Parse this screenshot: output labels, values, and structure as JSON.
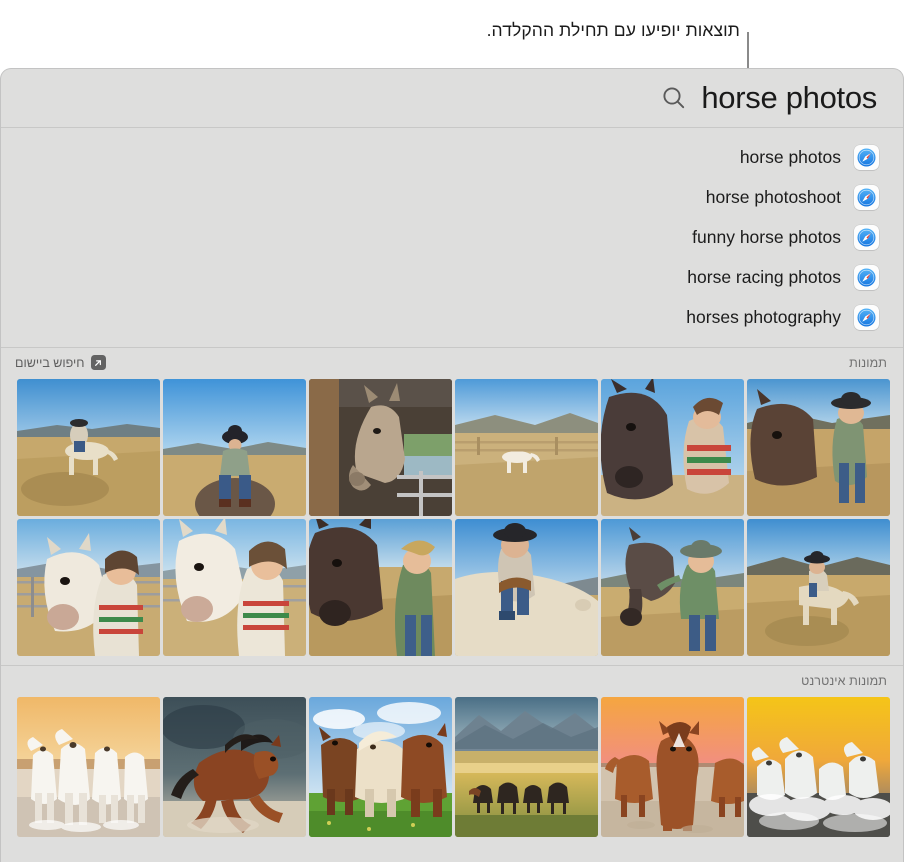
{
  "callout": {
    "text": "תוצאות יופיעו עם תחילת ההקלדה."
  },
  "search": {
    "value": "horse photos",
    "icon": "search-icon"
  },
  "suggestions": [
    {
      "label": "horse photos",
      "icon": "safari-compass-icon"
    },
    {
      "label": "horse photoshoot",
      "icon": "safari-compass-icon"
    },
    {
      "label": "funny horse photos",
      "icon": "safari-compass-icon"
    },
    {
      "label": "horse racing photos",
      "icon": "safari-compass-icon"
    },
    {
      "label": "horses photography",
      "icon": "safari-compass-icon"
    }
  ],
  "photos_section": {
    "title": "תמונות",
    "in_app_search_label": "חיפוש ביישום",
    "in_app_search_icon": "arrow-up-right-icon",
    "rows": [
      [
        {
          "caption": "girl riding palomino horse in dry field"
        },
        {
          "caption": "girl in black cowboy hat riding horse"
        },
        {
          "caption": "horse head in barn stall"
        },
        {
          "caption": "white horse in fenced pasture"
        },
        {
          "caption": "girl with dark horse close up"
        },
        {
          "caption": "child leading horse in field"
        }
      ],
      [
        {
          "caption": "girl hugging white horse"
        },
        {
          "caption": "girl leaning on white horse"
        },
        {
          "caption": "girl petting dark horse mane"
        },
        {
          "caption": "girl riding palomino with saddle"
        },
        {
          "caption": "child in hat standing with horse"
        },
        {
          "caption": "rider on palomino in open field"
        }
      ]
    ]
  },
  "internet_section": {
    "title": "תמונות אינטרנט",
    "rows": [
      [
        {
          "caption": "white horses running through water at sunset"
        },
        {
          "caption": "brown horse galloping in dust storm"
        },
        {
          "caption": "three horses running in green field"
        },
        {
          "caption": "dark horses in valley with mountains"
        },
        {
          "caption": "brown horses on beach at sunset"
        },
        {
          "caption": "white horses splashing in water golden sky"
        }
      ]
    ]
  },
  "colors": {
    "panel_bg": "#dededd",
    "text": "#1c1c1c",
    "muted_text": "#717171",
    "safari_blue": "#1e8cf0"
  }
}
